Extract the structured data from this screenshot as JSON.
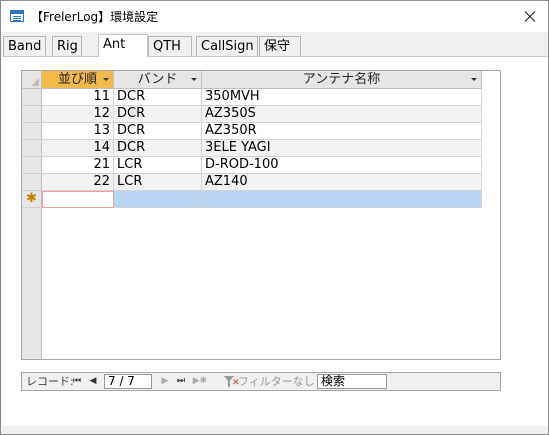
{
  "window": {
    "title": "【FrelerLog】環境設定"
  },
  "tabs": [
    {
      "label": "Band"
    },
    {
      "label": "Rig"
    },
    {
      "label": "Ant"
    },
    {
      "label": "QTH"
    },
    {
      "label": "CallSign"
    },
    {
      "label": "保守"
    }
  ],
  "active_tab": "Ant",
  "grid": {
    "columns": [
      {
        "label": "並び順"
      },
      {
        "label": "バンド"
      },
      {
        "label": "アンテナ名称"
      }
    ],
    "rows": [
      {
        "order": "11",
        "band": "DCR",
        "antenna": "350MVH"
      },
      {
        "order": "12",
        "band": "DCR",
        "antenna": "AZ350S"
      },
      {
        "order": "13",
        "band": "DCR",
        "antenna": "AZ350R"
      },
      {
        "order": "14",
        "band": "DCR",
        "antenna": "3ELE YAGI"
      },
      {
        "order": "21",
        "band": "LCR",
        "antenna": "D-ROD-100"
      },
      {
        "order": "22",
        "band": "LCR",
        "antenna": "AZ140"
      }
    ],
    "new_row_marker": "✱"
  },
  "navigator": {
    "record_label": "レコード:",
    "first": "⏮",
    "prev": "◀",
    "position": "7 / 7",
    "next": "▶",
    "last": "⏭",
    "new": "▶✱",
    "filter_label": "フィルターなし",
    "search_placeholder": "検索"
  },
  "colors": {
    "sorted_header": "#f3b94a",
    "new_row": "#b9d5f2",
    "alt_row": "#f2f2f2"
  }
}
